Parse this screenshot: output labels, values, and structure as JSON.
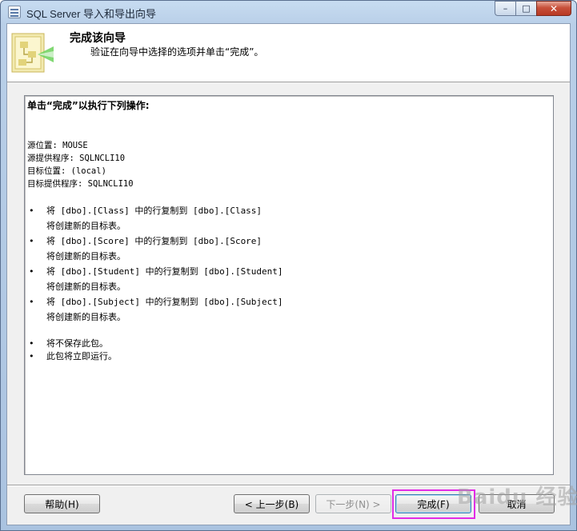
{
  "window": {
    "title": "SQL Server 导入和导出向导",
    "controls": {
      "minimize": "–",
      "maximize": "□",
      "close": "✕"
    }
  },
  "header": {
    "title": "完成该向导",
    "description": "验证在向导中选择的选项并单击“完成”。",
    "icon": "wizard-icon"
  },
  "summary": {
    "heading": "单击“完成”以执行下列操作:",
    "connection_lines": [
      "源位置: MOUSE",
      "源提供程序: SQLNCLI10",
      "目标位置: (local)",
      "目标提供程序: SQLNCLI10"
    ],
    "copy_actions": [
      {
        "bullet": "•",
        "text": "将 [dbo].[Class] 中的行复制到 [dbo].[Class]",
        "sub": "将创建新的目标表。"
      },
      {
        "bullet": "•",
        "text": "将 [dbo].[Score] 中的行复制到 [dbo].[Score]",
        "sub": "将创建新的目标表。"
      },
      {
        "bullet": "•",
        "text": "将 [dbo].[Student] 中的行复制到 [dbo].[Student]",
        "sub": "将创建新的目标表。"
      },
      {
        "bullet": "•",
        "text": "将 [dbo].[Subject] 中的行复制到 [dbo].[Subject]",
        "sub": "将创建新的目标表。"
      }
    ],
    "final_actions": [
      {
        "bullet": "•",
        "text": "将不保存此包。"
      },
      {
        "bullet": "•",
        "text": "此包将立即运行。"
      }
    ]
  },
  "buttons": {
    "help": "帮助(H)",
    "back": "< 上一步(B)",
    "next": "下一步(N) >",
    "finish": "完成(F)",
    "cancel": "取消"
  },
  "watermark": "Baidu 经验",
  "colors": {
    "highlight": "#e22ce6",
    "title_bar": "#b9cfe8",
    "close_button": "#c7503a"
  }
}
